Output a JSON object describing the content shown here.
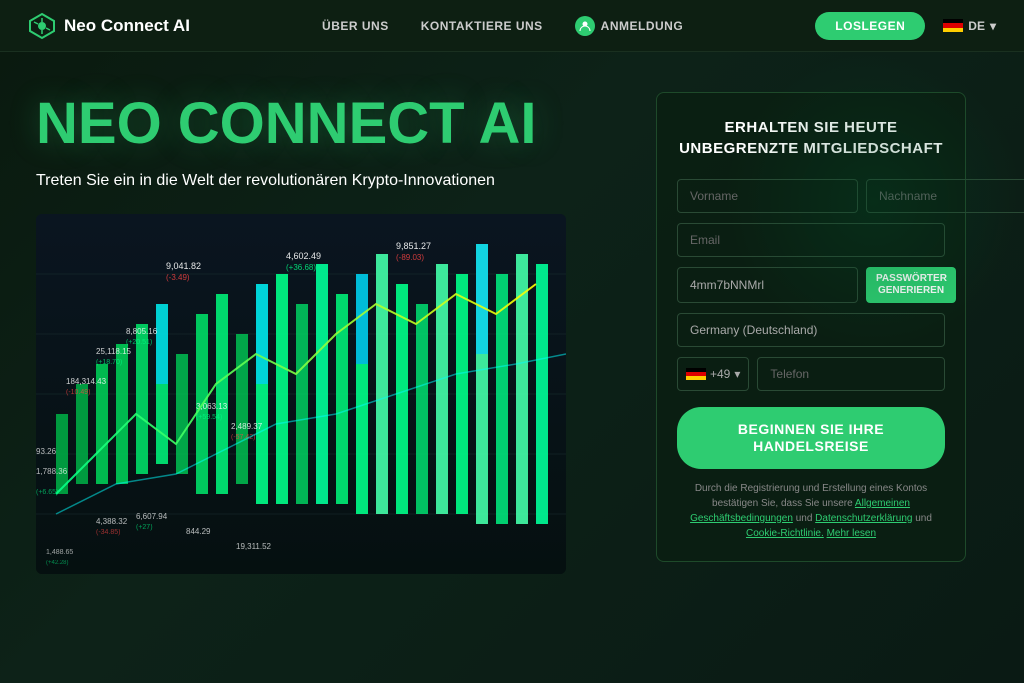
{
  "nav": {
    "logo_text": "Neo Connect AI",
    "link_uber": "ÜBER UNS",
    "link_kontakt": "KONTAKTIERE UNS",
    "link_anmeldung": "ANMELDUNG",
    "btn_loslegen": "LOSLEGEN",
    "lang": "DE"
  },
  "hero": {
    "title": "NEO CONNECT AI",
    "subtitle": "Treten Sie ein in die Welt der revolutionären Krypto-Innovationen"
  },
  "signup": {
    "title": "ERHALTEN SIE HEUTE UNBEGRENZTE MITGLIEDSCHAFT",
    "placeholder_firstname": "Vorname",
    "placeholder_lastname": "Nachname",
    "placeholder_email": "Email",
    "password_value": "4mm7bNNMrl",
    "btn_generate": "PASSWÖRTER GENERIEREN",
    "country_value": "Germany (Deutschland)",
    "phone_prefix": "+49",
    "placeholder_phone": "Telefon",
    "btn_start_line1": "BEGINNEN SIE IHRE",
    "btn_start_line2": "HANDELSREISE",
    "legal_text": "Durch die Registrierung und Erstellung eines Kontos bestätigen Sie, dass Sie unsere",
    "legal_agb": "Allgemeinen Geschäftsbedingungen",
    "legal_and": "und",
    "legal_datenschutz": "Datenschutzerklärung",
    "legal_and2": "und",
    "legal_cookie": "Cookie-Richtlinie.",
    "legal_more": "Mehr lesen"
  }
}
